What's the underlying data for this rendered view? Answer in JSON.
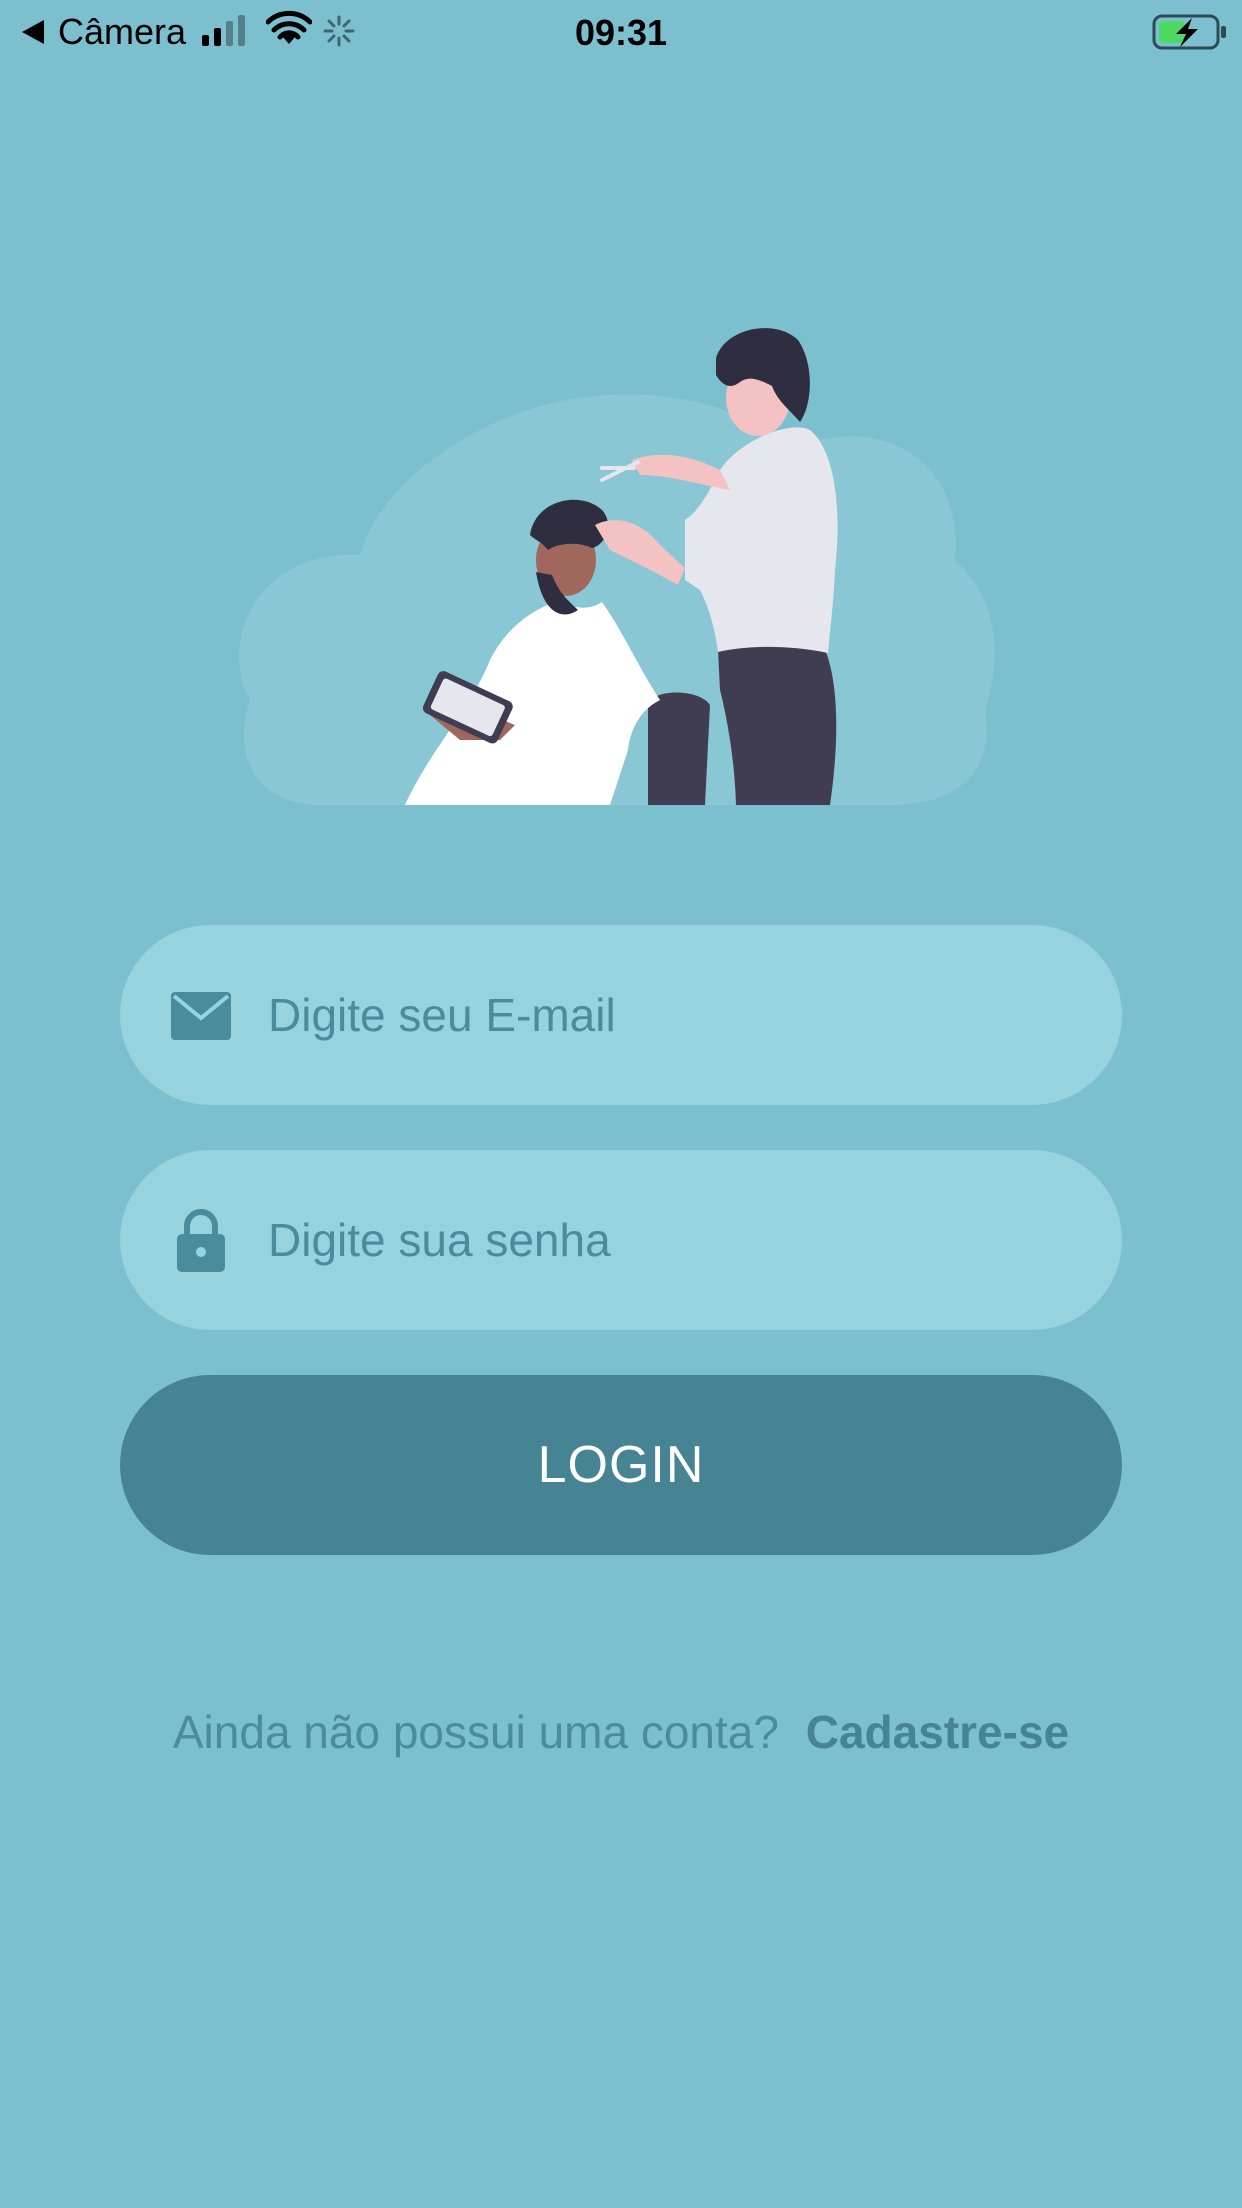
{
  "status_bar": {
    "back_label": "Câmera",
    "time": "09:31",
    "battery_color": "#4cd964"
  },
  "colors": {
    "background": "#7cbfcf",
    "field_background": "#97d2df",
    "button_background": "#468393",
    "accent_text": "#468393"
  },
  "illustration": {
    "subject": "barber-cutting-hair-illustration"
  },
  "login_form": {
    "email": {
      "placeholder": "Digite seu E-mail",
      "value": "",
      "icon": "envelope-icon"
    },
    "password": {
      "placeholder": "Digite sua senha",
      "value": "",
      "icon": "lock-icon"
    },
    "submit_label": "LOGIN"
  },
  "signup": {
    "prompt": "Ainda não possui uma conta?",
    "link_label": "Cadastre-se"
  }
}
